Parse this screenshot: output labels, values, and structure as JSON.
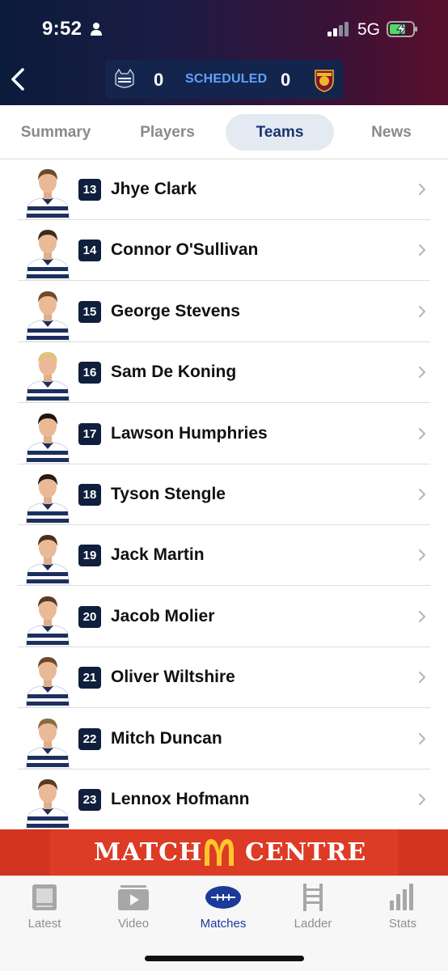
{
  "status_bar": {
    "time": "9:52",
    "network": "5G"
  },
  "match": {
    "home_score": "0",
    "status": "SCHEDULED",
    "away_score": "0",
    "home_logo": "geelong-cats-logo",
    "away_logo": "brisbane-lions-logo"
  },
  "tabs": [
    {
      "label": "Summary",
      "active": false
    },
    {
      "label": "Players",
      "active": false
    },
    {
      "label": "Teams",
      "active": true
    },
    {
      "label": "News",
      "active": false
    }
  ],
  "players": [
    {
      "number": "13",
      "name": "Jhye Clark"
    },
    {
      "number": "14",
      "name": "Connor O'Sullivan"
    },
    {
      "number": "15",
      "name": "George Stevens"
    },
    {
      "number": "16",
      "name": "Sam De Koning"
    },
    {
      "number": "17",
      "name": "Lawson Humphries"
    },
    {
      "number": "18",
      "name": "Tyson Stengle"
    },
    {
      "number": "19",
      "name": "Jack Martin"
    },
    {
      "number": "20",
      "name": "Jacob Molier"
    },
    {
      "number": "21",
      "name": "Oliver Wiltshire"
    },
    {
      "number": "22",
      "name": "Mitch Duncan"
    },
    {
      "number": "23",
      "name": "Lennox Hofmann"
    }
  ],
  "banner": {
    "left_text": "MATCH",
    "right_text": "CENTRE",
    "logo": "mcdonalds-logo"
  },
  "nav": [
    {
      "label": "Latest",
      "icon": "latest-icon",
      "active": false
    },
    {
      "label": "Video",
      "icon": "video-icon",
      "active": false
    },
    {
      "label": "Matches",
      "icon": "football-icon",
      "active": true
    },
    {
      "label": "Ladder",
      "icon": "ladder-icon",
      "active": false
    },
    {
      "label": "Stats",
      "icon": "stats-icon",
      "active": false
    }
  ],
  "colors": {
    "header_navy": "#14254d",
    "badge_navy": "#0f1f3d",
    "status_blue": "#5fa1ff",
    "active_tab_bg": "#e4eaf2",
    "active_tab_text": "#1a3570",
    "banner_red": "#dd3b25",
    "nav_active": "#1a3a9a"
  }
}
